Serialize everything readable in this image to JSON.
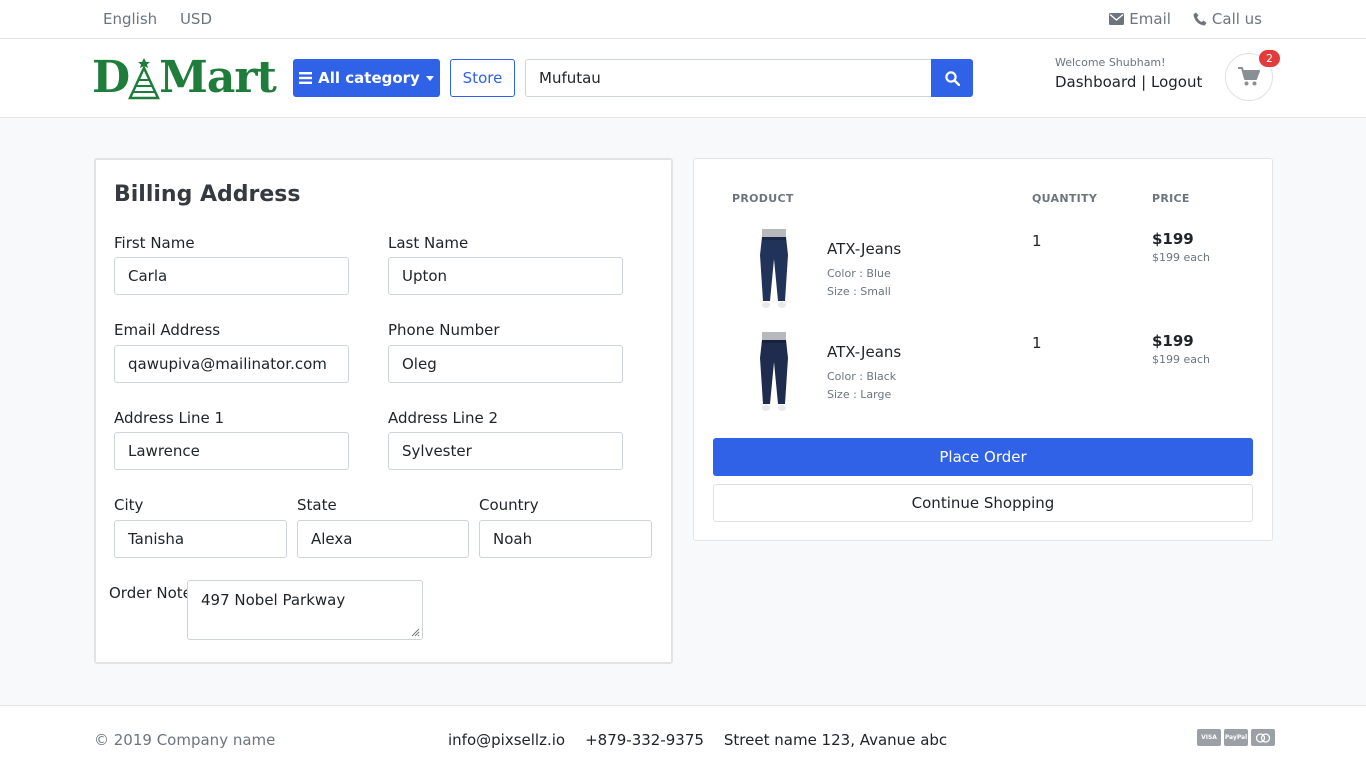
{
  "topbar": {
    "language": "English",
    "currency": "USD",
    "email_label": "Email",
    "call_label": "Call us"
  },
  "header": {
    "logo_left": "D",
    "logo_right": "Mart",
    "category_label": "All category",
    "store_label": "Store",
    "search_value": "Mufutau",
    "welcome": "Welcome Shubham!",
    "dashboard_label": "Dashboard",
    "separator": "|",
    "logout_label": "Logout",
    "cart_count": "2"
  },
  "billing": {
    "title": "Billing Address",
    "first_name": {
      "label": "First Name",
      "value": "Carla"
    },
    "last_name": {
      "label": "Last Name",
      "value": "Upton"
    },
    "email": {
      "label": "Email Address",
      "value": "qawupiva@mailinator.com"
    },
    "phone": {
      "label": "Phone Number",
      "value": "Oleg"
    },
    "address1": {
      "label": "Address Line 1",
      "value": "Lawrence"
    },
    "address2": {
      "label": "Address Line 2",
      "value": "Sylvester"
    },
    "city": {
      "label": "City",
      "value": "Tanisha"
    },
    "state": {
      "label": "State",
      "value": "Alexa"
    },
    "country": {
      "label": "Country",
      "value": "Noah"
    },
    "order_note": {
      "label": "Order Note",
      "value": "497 Nobel Parkway"
    }
  },
  "cart": {
    "headers": {
      "product": "PRODUCT",
      "quantity": "QUANTITY",
      "price": "PRICE"
    },
    "items": [
      {
        "name": "ATX-Jeans",
        "color": "Color : Blue",
        "size": "Size : Small",
        "qty": "1",
        "price": "$199",
        "each": "$199 each",
        "jeans_color": "#22335a"
      },
      {
        "name": "ATX-Jeans",
        "color": "Color : Black",
        "size": "Size : Large",
        "qty": "1",
        "price": "$199",
        "each": "$199 each",
        "jeans_color": "#1f2c4d"
      }
    ],
    "place_order_label": "Place Order",
    "continue_label": "Continue Shopping"
  },
  "footer": {
    "copyright": "© 2019 Company name",
    "email": "info@pixsellz.io",
    "phone": "+879-332-9375",
    "address": "Street name 123, Avanue abc",
    "payments": [
      "VISA",
      "PayPal",
      "MC"
    ]
  },
  "colors": {
    "primary": "#2f62e6",
    "brand_green": "#1e7d3b",
    "badge_red": "#e33b3b"
  }
}
